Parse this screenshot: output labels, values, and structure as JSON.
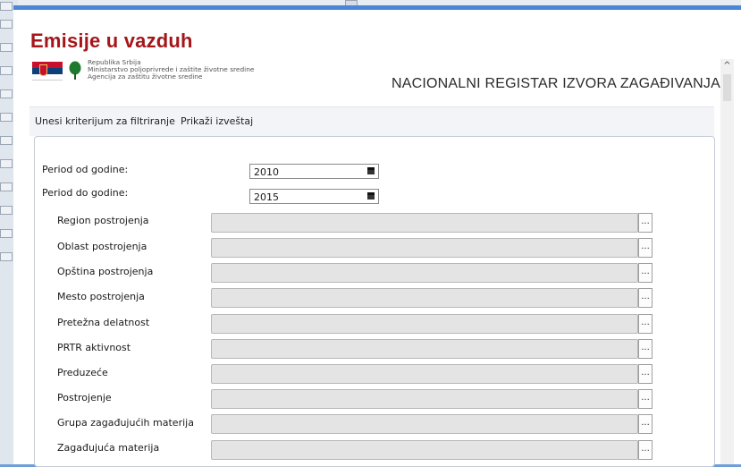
{
  "window": {
    "title": "Emisije u vazduh"
  },
  "header": {
    "gov_lines": [
      "Republika Srbija",
      "Ministarstvo poljoprivrede i zaštite životne sredine",
      "Agencija za zaštitu životne sredine"
    ],
    "registry_title": "NACIONALNI REGISTAR IZVORA ZAGAĐIVANJA",
    "flag_colors": [
      "#c8102e",
      "#0c4076",
      "#ffffff"
    ]
  },
  "menu": {
    "items": [
      {
        "label": "Unesi kriterijum za filtriranje"
      },
      {
        "label": "Prikaži izveštaj"
      }
    ]
  },
  "filters": {
    "period_from": {
      "label": "Period od godine:",
      "value": "2010"
    },
    "period_to": {
      "label": "Period do godine:",
      "value": "2015"
    },
    "fields": [
      {
        "label": "Region postrojenja"
      },
      {
        "label": "Oblast postrojenja"
      },
      {
        "label": "Opština postrojenja"
      },
      {
        "label": "Mesto postrojenja"
      },
      {
        "label": "Pretežna delatnost"
      },
      {
        "label": "PRTR aktivnost"
      },
      {
        "label": "Preduzeće"
      },
      {
        "label": "Postrojenje"
      },
      {
        "label": "Grupa zagađujućih materija"
      },
      {
        "label": "Zagađujuća materija"
      }
    ],
    "browse_label": "..."
  },
  "scrollbar": {
    "up_glyph": "^"
  }
}
